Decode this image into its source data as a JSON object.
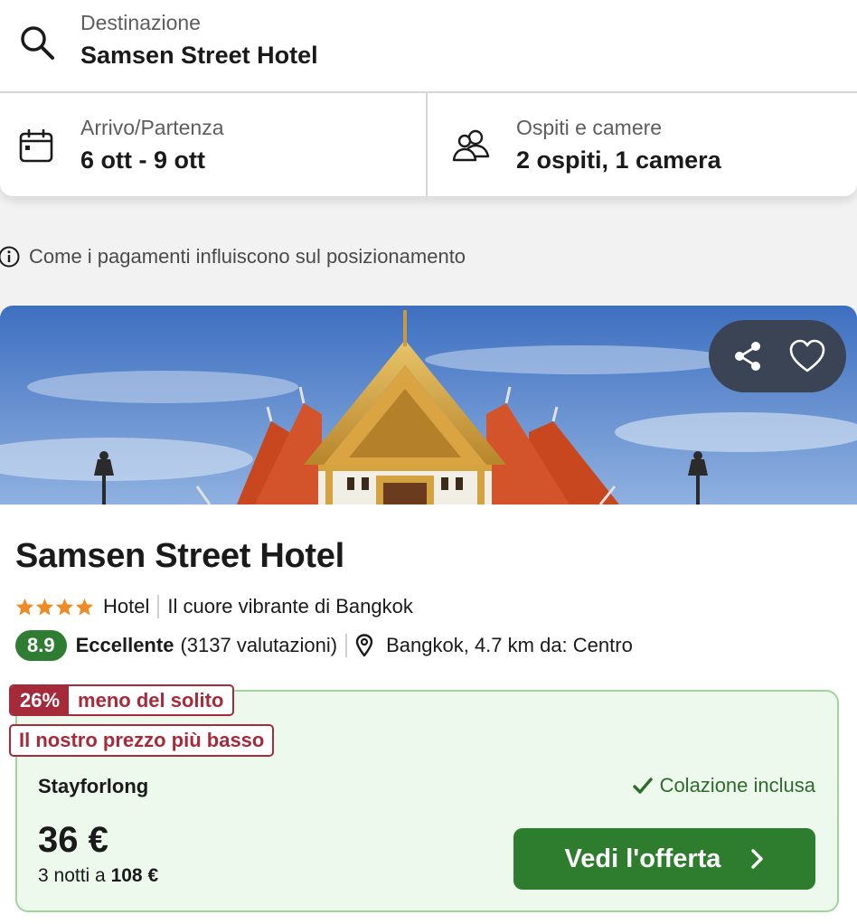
{
  "search": {
    "destination_label": "Destinazione",
    "destination_value": "Samsen Street Hotel",
    "dates_label": "Arrivo/Partenza",
    "dates_value": "6 ott - 9 ott",
    "guests_label": "Ospiti e camere",
    "guests_value": "2 ospiti, 1 camera",
    "icons": {
      "destination": "search-icon",
      "dates": "calendar-icon",
      "guests": "people-icon"
    }
  },
  "payments_note": {
    "icon": "info-icon",
    "text": "Come i pagamenti influiscono sul posizionamento"
  },
  "hotel": {
    "photo": "temple-photo",
    "share_icon": "share-icon",
    "favorite_icon": "heart-icon",
    "name": "Samsen Street Hotel",
    "stars": 4,
    "type": "Hotel",
    "tagline": "Il cuore vibrante di Bangkok",
    "score": "8.9",
    "rating_word": "Eccellente",
    "reviews": "(3137 valutazioni)",
    "location_icon": "map-pin-icon",
    "location": "Bangkok, 4.7 km da: Centro"
  },
  "deal": {
    "discount_pct": "26%",
    "discount_text": "meno del solito",
    "lowest_price_text": "Il nostro prezzo più basso",
    "provider": "Stayforlong",
    "breakfast": "Colazione inclusa",
    "price": "36 €",
    "nights_prefix": "3 notti a",
    "nights_total": "108 €",
    "cta_label": "Vedi l'offerta"
  },
  "colors": {
    "score_green": "#2f7d32",
    "cta_green": "#2e7d2e",
    "deal_bg": "#edf9ec",
    "deal_border": "#9ed69c",
    "badge_red": "#a52a3a",
    "star_orange": "#f08a24",
    "pill_bg": "#3a4454"
  }
}
